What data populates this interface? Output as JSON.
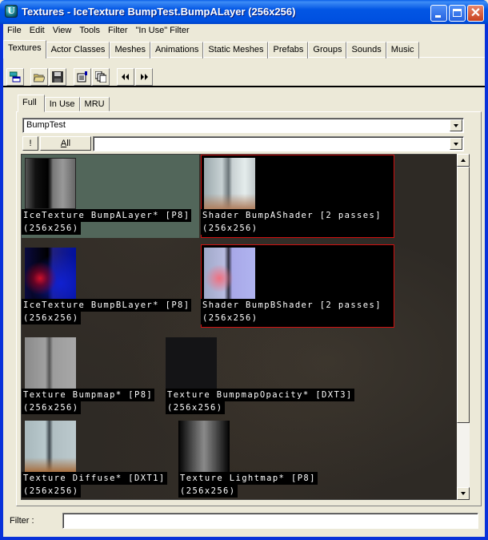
{
  "window": {
    "title": "Textures - IceTexture BumpTest.BumpALayer (256x256)",
    "app_icon": "unreal-u-icon",
    "controls": {
      "minimize": "_",
      "maximize": "□",
      "close": "✕"
    }
  },
  "menu": [
    "File",
    "Edit",
    "View",
    "Tools",
    "Filter",
    "\"In Use\" Filter"
  ],
  "main_tabs": [
    {
      "label": "Textures",
      "active": true
    },
    {
      "label": "Actor Classes"
    },
    {
      "label": "Meshes"
    },
    {
      "label": "Animations"
    },
    {
      "label": "Static Meshes"
    },
    {
      "label": "Prefabs"
    },
    {
      "label": "Groups"
    },
    {
      "label": "Sounds"
    },
    {
      "label": "Music"
    }
  ],
  "toolbar": {
    "icons": [
      "browser-windows-icon",
      "open-folder-icon",
      "save-disk-icon",
      "properties-icon",
      "duplicate-icon",
      "previous-icon",
      "next-icon"
    ],
    "glyphs": [
      "▤",
      "📂",
      "💾",
      "📝",
      "❐",
      "◀◀",
      "▶▶"
    ]
  },
  "inner_tabs": [
    {
      "label": "Full",
      "active": true
    },
    {
      "label": "In Use"
    },
    {
      "label": "MRU"
    }
  ],
  "package_combo": {
    "value": "BumpTest"
  },
  "group_row": {
    "bang_label": "!",
    "all_label": "All",
    "all_accel": "A",
    "all_rest": "ll",
    "group_value": ""
  },
  "textures": [
    {
      "name": "IceTexture BumpALayer* [P8]",
      "size": "(256x256)",
      "selected": true,
      "kind": "ice-a"
    },
    {
      "name": "Shader BumpAShader [2 passes]",
      "size": "(256x256)",
      "shader": true,
      "kind": "diffuse"
    },
    {
      "name": "IceTexture BumpBLayer* [P8]",
      "size": "(256x256)",
      "kind": "ice-b"
    },
    {
      "name": "Shader BumpBShader [2 passes]",
      "size": "(256x256)",
      "shader": true,
      "kind": "shader-b"
    },
    {
      "name": "Texture Bumpmap* [P8]",
      "size": "(256x256)",
      "kind": "bumpmap"
    },
    {
      "name": "Texture BumpmapOpacity* [DXT3]",
      "size": "(256x256)",
      "kind": "opacity"
    },
    {
      "name": "Texture Diffuse* [DXT1]",
      "size": "(256x256)",
      "kind": "diffuse"
    },
    {
      "name": "Texture Lightmap* [P8]",
      "size": "(256x256)",
      "kind": "lightmap"
    }
  ],
  "filter": {
    "label": "Filter :",
    "value": ""
  }
}
